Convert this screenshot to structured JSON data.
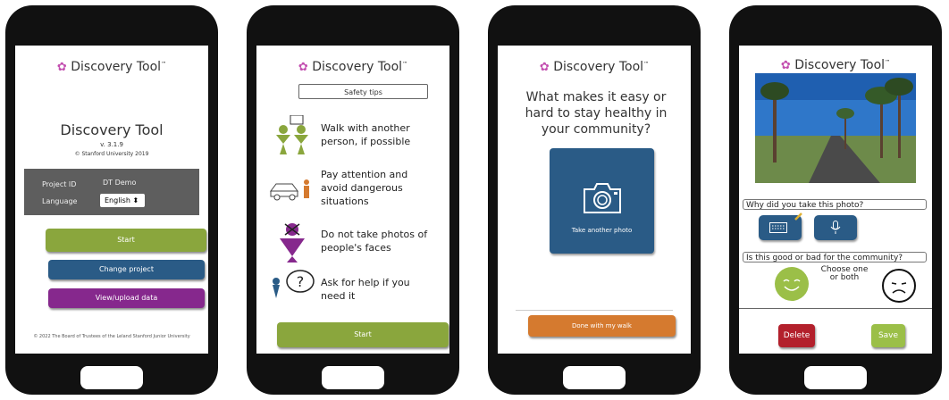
{
  "screen1": {
    "brand": "Discovery Tool",
    "tm": "™",
    "title": "Discovery Tool",
    "version": "v. 3.1.9",
    "copyright": "© Stanford University 2019",
    "project_label": "Project ID",
    "project_value": "DT Demo",
    "language_label": "Language",
    "language_value": "English",
    "start_label": "Start",
    "change_project_label": "Change project",
    "view_upload_label": "View/upload data",
    "footer": "© 2022 The Board of Trustees of the Leland Stanford Junior University"
  },
  "screen2": {
    "brand": "Discovery Tool",
    "tm": "™",
    "safety_tips_label": "Safety tips",
    "tips": [
      "Walk with another person, if possible",
      "Pay attention and avoid dangerous situations",
      "Do not take photos of people's faces",
      "Ask for help if you need it"
    ],
    "start_label": "Start"
  },
  "screen3": {
    "brand": "Discovery Tool",
    "tm": "™",
    "question": "What makes it easy or hard to stay healthy in your community?",
    "take_photo_label": "Take another photo",
    "done_label": "Done with my walk"
  },
  "screen4": {
    "brand": "Discovery Tool",
    "tm": "™",
    "why_label": "Why did you take this photo?",
    "good_bad_label": "Is this good or bad for the community?",
    "choose_label": "Choose one or both",
    "delete_label": "Delete",
    "save_label": "Save"
  },
  "colors": {
    "green": "#8aa63d",
    "blue": "#2a5b86",
    "purple": "#86288d",
    "orange": "#d57a2f",
    "red": "#b3202c",
    "save_green": "#9bbf48",
    "dark_panel": "#5e5e5e"
  }
}
